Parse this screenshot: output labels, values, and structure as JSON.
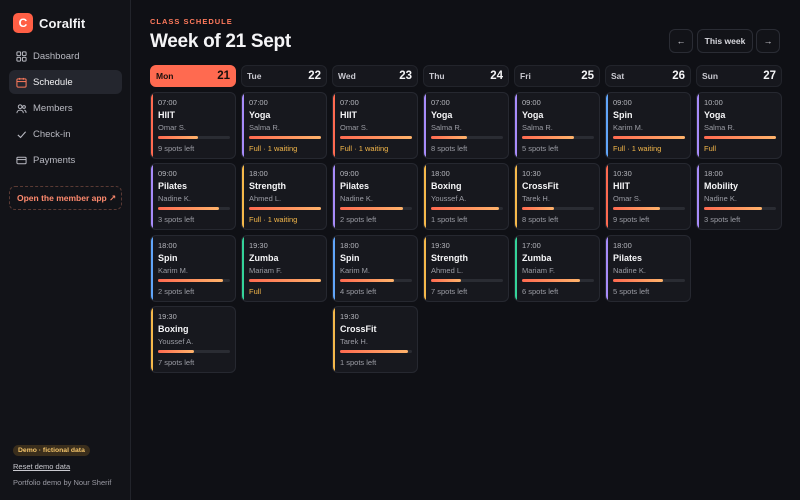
{
  "app": {
    "name": "Coralfit",
    "logo_letter": "C",
    "accent": "#ff6a50"
  },
  "sidebar": {
    "items": [
      {
        "label": "Dashboard",
        "icon": "dashboard-icon",
        "active": false
      },
      {
        "label": "Schedule",
        "icon": "calendar-icon",
        "active": true
      },
      {
        "label": "Members",
        "icon": "users-icon",
        "active": false
      },
      {
        "label": "Check-in",
        "icon": "check-icon",
        "active": false
      },
      {
        "label": "Payments",
        "icon": "card-icon",
        "active": false
      }
    ],
    "member_app_link": "Open the member app ↗",
    "demo_badge": "Demo · fictional data",
    "reset_link": "Reset demo data",
    "footer": "Portfolio demo by Nour Sherif"
  },
  "header": {
    "eyebrow": "CLASS SCHEDULE",
    "title": "Week of 21 Sept",
    "prev_label": "←",
    "week_label": "This week",
    "next_label": "→"
  },
  "days": [
    {
      "name": "Mon",
      "num": "21",
      "today": true,
      "classes": [
        {
          "time": "07:00",
          "name": "HIIT",
          "coach": "Omar S.",
          "status": "9 spots left",
          "full": false,
          "fill": 0.55,
          "color": "#ff6a50"
        },
        {
          "time": "09:00",
          "name": "Pilates",
          "coach": "Nadine K.",
          "status": "3 spots left",
          "full": false,
          "fill": 0.85,
          "color": "#a78bfa"
        },
        {
          "time": "18:00",
          "name": "Spin",
          "coach": "Karim M.",
          "status": "2 spots left",
          "full": false,
          "fill": 0.9,
          "color": "#60a5fa"
        },
        {
          "time": "19:30",
          "name": "Boxing",
          "coach": "Youssef A.",
          "status": "7 spots left",
          "full": false,
          "fill": 0.5,
          "color": "#f5b84a"
        }
      ]
    },
    {
      "name": "Tue",
      "num": "22",
      "today": false,
      "classes": [
        {
          "time": "07:00",
          "name": "Yoga",
          "coach": "Salma R.",
          "status": "Full · 1 waiting",
          "full": true,
          "fill": 1.0,
          "color": "#a78bfa"
        },
        {
          "time": "18:00",
          "name": "Strength",
          "coach": "Ahmed L.",
          "status": "Full · 1 waiting",
          "full": true,
          "fill": 1.0,
          "color": "#f5b84a"
        },
        {
          "time": "19:30",
          "name": "Zumba",
          "coach": "Mariam F.",
          "status": "Full",
          "full": true,
          "fill": 1.0,
          "color": "#34d399"
        }
      ]
    },
    {
      "name": "Wed",
      "num": "23",
      "today": false,
      "classes": [
        {
          "time": "07:00",
          "name": "HIIT",
          "coach": "Omar S.",
          "status": "Full · 1 waiting",
          "full": true,
          "fill": 1.0,
          "color": "#ff6a50"
        },
        {
          "time": "09:00",
          "name": "Pilates",
          "coach": "Nadine K.",
          "status": "2 spots left",
          "full": false,
          "fill": 0.88,
          "color": "#a78bfa"
        },
        {
          "time": "18:00",
          "name": "Spin",
          "coach": "Karim M.",
          "status": "4 spots left",
          "full": false,
          "fill": 0.75,
          "color": "#60a5fa"
        },
        {
          "time": "19:30",
          "name": "CrossFit",
          "coach": "Tarek H.",
          "status": "1 spots left",
          "full": false,
          "fill": 0.95,
          "color": "#f5b84a"
        }
      ]
    },
    {
      "name": "Thu",
      "num": "24",
      "today": false,
      "classes": [
        {
          "time": "07:00",
          "name": "Yoga",
          "coach": "Salma R.",
          "status": "8 spots left",
          "full": false,
          "fill": 0.5,
          "color": "#a78bfa"
        },
        {
          "time": "18:00",
          "name": "Boxing",
          "coach": "Youssef A.",
          "status": "1 spots left",
          "full": false,
          "fill": 0.95,
          "color": "#f5b84a"
        },
        {
          "time": "19:30",
          "name": "Strength",
          "coach": "Ahmed L.",
          "status": "7 spots left",
          "full": false,
          "fill": 0.42,
          "color": "#f5b84a"
        }
      ]
    },
    {
      "name": "Fri",
      "num": "25",
      "today": false,
      "classes": [
        {
          "time": "09:00",
          "name": "Yoga",
          "coach": "Salma R.",
          "status": "5 spots left",
          "full": false,
          "fill": 0.72,
          "color": "#a78bfa"
        },
        {
          "time": "10:30",
          "name": "CrossFit",
          "coach": "Tarek H.",
          "status": "8 spots left",
          "full": false,
          "fill": 0.45,
          "color": "#f5b84a"
        },
        {
          "time": "17:00",
          "name": "Zumba",
          "coach": "Mariam F.",
          "status": "6 spots left",
          "full": false,
          "fill": 0.8,
          "color": "#34d399"
        }
      ]
    },
    {
      "name": "Sat",
      "num": "26",
      "today": false,
      "classes": [
        {
          "time": "09:00",
          "name": "Spin",
          "coach": "Karim M.",
          "status": "Full · 1 waiting",
          "full": true,
          "fill": 1.0,
          "color": "#60a5fa"
        },
        {
          "time": "10:30",
          "name": "HIIT",
          "coach": "Omar S.",
          "status": "9 spots left",
          "full": false,
          "fill": 0.65,
          "color": "#ff6a50"
        },
        {
          "time": "18:00",
          "name": "Pilates",
          "coach": "Nadine K.",
          "status": "5 spots left",
          "full": false,
          "fill": 0.7,
          "color": "#a78bfa"
        }
      ]
    },
    {
      "name": "Sun",
      "num": "27",
      "today": false,
      "classes": [
        {
          "time": "10:00",
          "name": "Yoga",
          "coach": "Salma R.",
          "status": "Full",
          "full": true,
          "fill": 1.0,
          "color": "#a78bfa"
        },
        {
          "time": "18:00",
          "name": "Mobility",
          "coach": "Nadine K.",
          "status": "3 spots left",
          "full": false,
          "fill": 0.8,
          "color": "#a78bfa"
        }
      ]
    }
  ]
}
